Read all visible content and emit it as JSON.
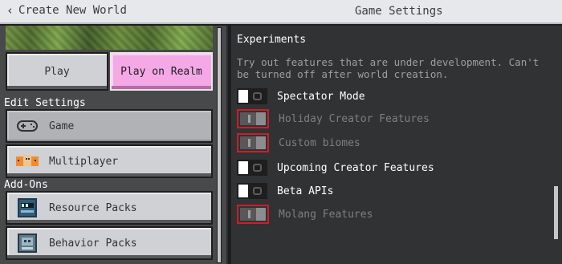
{
  "header": {
    "back_label": "Create New World",
    "title": "Game Settings"
  },
  "left": {
    "play_label": "Play",
    "play_realm_label": "Play on Realm",
    "edit_settings_label": "Edit Settings",
    "nav": [
      {
        "label": "Game",
        "icon": "controller-icon",
        "selected": true
      },
      {
        "label": "Multiplayer",
        "icon": "multiplayer-icon",
        "selected": false
      }
    ],
    "addons_label": "Add-Ons",
    "addons": [
      {
        "label": "Resource Packs",
        "icon": "resource-pack-icon"
      },
      {
        "label": "Behavior Packs",
        "icon": "behavior-pack-icon"
      }
    ]
  },
  "experiments": {
    "title": "Experiments",
    "description": "Try out features that are under development. Can't be turned off after world creation.",
    "toggles": [
      {
        "label": "Spectator Mode",
        "state": "off",
        "locked": false
      },
      {
        "label": "Holiday Creator Features",
        "state": "on",
        "locked": true
      },
      {
        "label": "Custom biomes",
        "state": "on",
        "locked": true
      },
      {
        "label": "Upcoming Creator Features",
        "state": "off",
        "locked": false
      },
      {
        "label": "Beta APIs",
        "state": "off",
        "locked": false
      },
      {
        "label": "Molang Features",
        "state": "on",
        "locked": true
      }
    ]
  },
  "colors": {
    "accent_pink": "#f5a8e6",
    "locked_border": "#c8202a"
  }
}
